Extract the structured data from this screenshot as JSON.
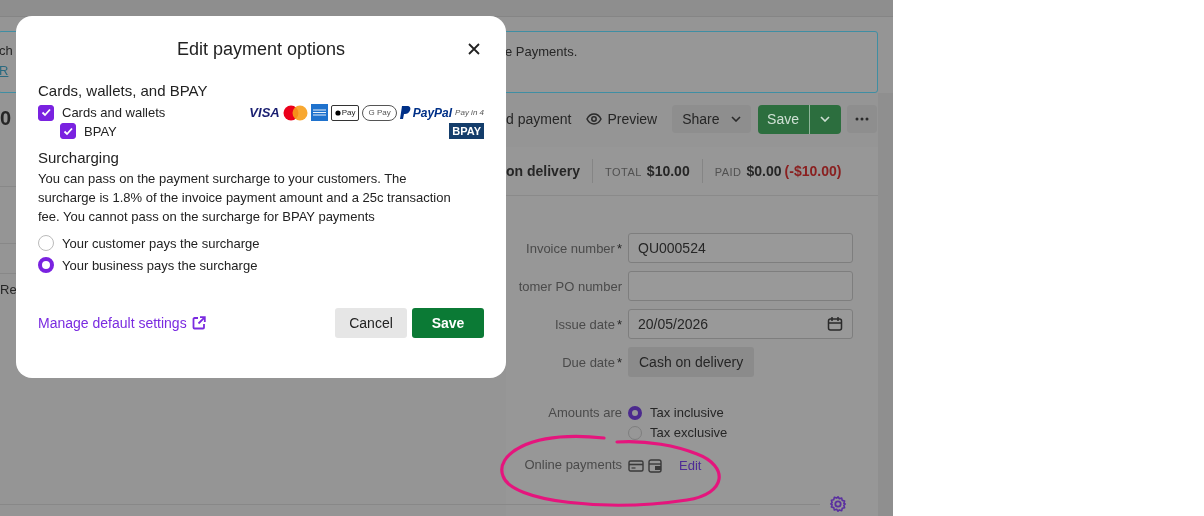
{
  "page": {
    "banner": {
      "text_left": "ch",
      "link_left": "R",
      "text_right": "e Payments."
    },
    "title_fragment": "0",
    "side_fragment": "Re",
    "toolbar": {
      "actions": [
        {
          "kind": "text",
          "label": "d payment"
        },
        {
          "kind": "preview",
          "label": "Preview"
        }
      ],
      "share": "Share",
      "save": "Save"
    },
    "summary": {
      "due": "on delivery",
      "total_label": "TOTAL",
      "total": "$10.00",
      "paid_label": "PAID",
      "paid": "$0.00",
      "balance": "(-$10.00)"
    },
    "form": {
      "fields": [
        {
          "label": "Invoice number",
          "required_mark": "*",
          "kind": "text",
          "value": "QU000524"
        },
        {
          "label": "tomer PO number",
          "kind": "text"
        },
        {
          "label": "Issue date",
          "required_mark": "*",
          "kind": "date",
          "value": "20/05/2026"
        },
        {
          "label": "Due date",
          "required_mark": "*",
          "kind": "button",
          "value": "Cash on delivery"
        }
      ],
      "amounts_label": "Amounts are",
      "amounts_options": [
        {
          "label": "Tax inclusive",
          "selected": true
        },
        {
          "label": "Tax exclusive",
          "selected": false
        }
      ],
      "online_label": "Online payments",
      "edit_link": "Edit"
    }
  },
  "modal": {
    "title": "Edit payment options",
    "methods": {
      "heading": "Cards, wallets, and BPAY",
      "options": [
        {
          "kind": "cards",
          "label": "Cards and wallets",
          "checked": true
        },
        {
          "kind": "bpay",
          "label": "BPAY",
          "checked": true
        }
      ],
      "logos": [
        {
          "kind": "visa",
          "text": "VISA"
        },
        {
          "kind": "mastercard"
        },
        {
          "kind": "amex"
        },
        {
          "kind": "applepay",
          "text": "Pay"
        },
        {
          "kind": "googlepay",
          "text": "G Pay"
        },
        {
          "kind": "paypal",
          "text": "PayPal"
        },
        {
          "kind": "payin4",
          "text": "Pay in 4"
        }
      ],
      "bpay_logo": "BPAY"
    },
    "surcharging": {
      "heading": "Surcharging",
      "description": "You can pass on the payment surcharge to your customers. The surcharge is 1.8% of the invoice payment amount and a 25c transaction fee. You cannot pass on the surcharge for BPAY payments",
      "options": [
        {
          "label": "Your customer pays the surcharge",
          "selected": false
        },
        {
          "label": "Your business pays the surcharge",
          "selected": true
        }
      ]
    },
    "link": "Manage default settings",
    "buttons": [
      {
        "kind": "secondary",
        "label": "Cancel"
      },
      {
        "kind": "primary",
        "label": "Save"
      }
    ]
  }
}
